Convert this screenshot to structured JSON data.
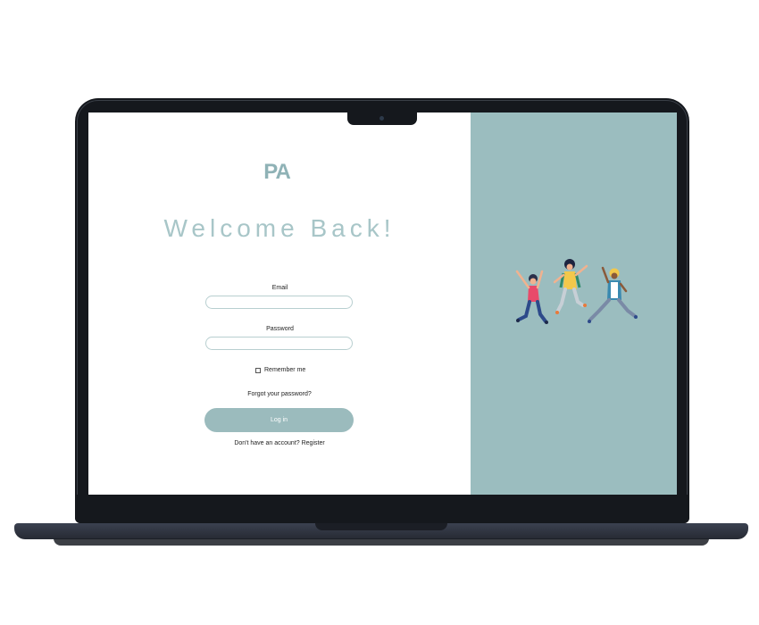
{
  "login": {
    "logo_text": "PA",
    "heading": "Welcome Back!",
    "email_label": "Email",
    "email_value": "",
    "password_label": "Password",
    "password_value": "",
    "remember_label": "Remember me",
    "forgot_link": "Forgot your password?",
    "login_button": "Log in",
    "register_text": "Don't have an account? Register"
  },
  "colors": {
    "accent": "#9bbbbd",
    "heading": "#a8c6c8",
    "illustration_bg": "#9bbdbf",
    "device_body": "#15181d"
  },
  "illustration": {
    "icon": "jumping-people-illustration"
  }
}
